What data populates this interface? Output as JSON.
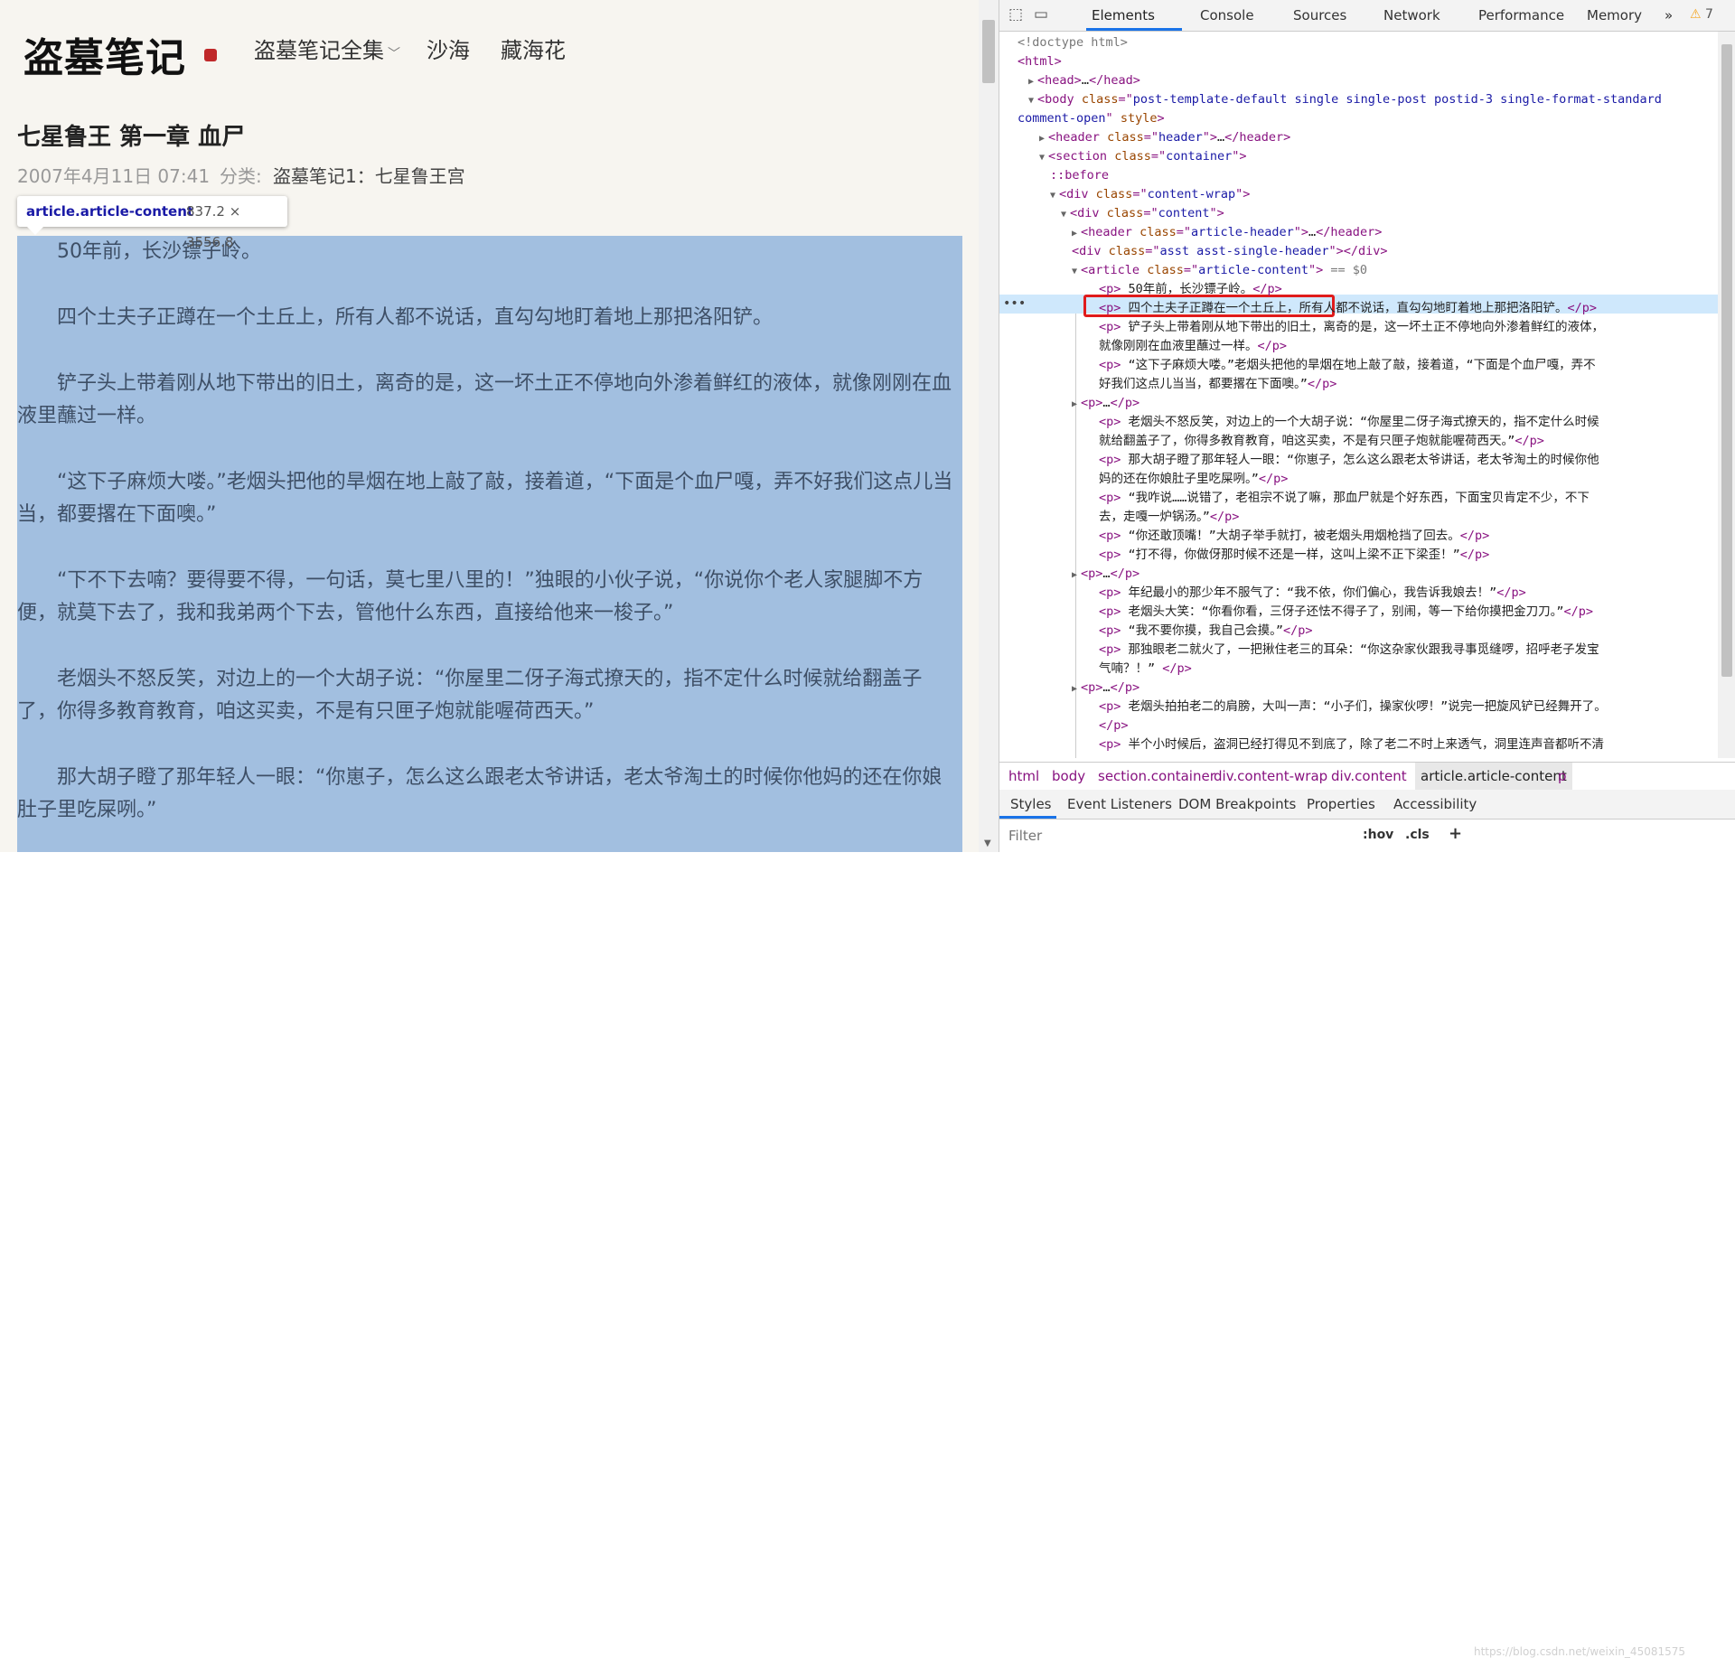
{
  "site": {
    "logo": "盗墓笔记",
    "nav": [
      {
        "label": "盗墓笔记全集",
        "has_dropdown": true
      },
      {
        "label": "沙海"
      },
      {
        "label": "藏海花"
      }
    ]
  },
  "article": {
    "title": "七星鲁王 第一章 血尸",
    "date": "2007年4月11日 07:41",
    "category_label": "分类:",
    "category": "盗墓笔记1：七星鲁王宫",
    "paragraphs": [
      "50年前，长沙镖子岭。",
      "四个土夫子正蹲在一个土丘上，所有人都不说话，直勾勾地盯着地上那把洛阳铲。",
      "铲子头上带着刚从地下带出的旧土，离奇的是，这一坏土正不停地向外渗着鲜红的液体，就像刚刚在血液里蘸过一样。",
      "“这下子麻烦大喽。”老烟头把他的旱烟在地上敲了敲，接着道，“下面是个血尸嘎，弄不好我们这点儿当当，都要撂在下面噢。”",
      "“下不下去喃？要得要不得，一句话，莫七里八里的！”独眼的小伙子说，“你说你个老人家腿脚不方便，就莫下去了，我和我弟两个下去，管他什么东西，直接给他来一梭子。”",
      "老烟头不怒反笑，对边上的一个大胡子说：“你屋里二伢子海式撩天的，指不定什么时候就给翻盖子了，你得多教育教育，咱这买卖，不是有只匣子炮就能喔荷西天。”",
      "那大胡子瞪了那年轻人一眼：“你崽子，怎么这么跟老太爷讲话，老太爷淘土的时候你他妈的还在你娘肚子里吃屎咧。”"
    ]
  },
  "inspect_tooltip": {
    "element": "article.article-content",
    "size": "837.2 × 3556.8"
  },
  "devtools": {
    "tabs": [
      "Elements",
      "Console",
      "Sources",
      "Network",
      "Performance",
      "Memory"
    ],
    "more": "»",
    "warnings": "7",
    "dom_lines": [
      {
        "indent": 0,
        "tri": "",
        "parts": [
          [
            "cm",
            "<!doctype html>"
          ]
        ]
      },
      {
        "indent": 0,
        "tri": "",
        "parts": [
          [
            "tg",
            "<html>"
          ]
        ]
      },
      {
        "indent": 1,
        "tri": "▶",
        "parts": [
          [
            "tg",
            "<head>"
          ],
          [
            "tx",
            "…"
          ],
          [
            "tg",
            "</head>"
          ]
        ]
      },
      {
        "indent": 1,
        "tri": "▼",
        "parts": [
          [
            "tg",
            "<body "
          ],
          [
            "an",
            "class"
          ],
          [
            "tg",
            "=\""
          ],
          [
            "av",
            "post-template-default single single-post postid-3 single-format-standard"
          ]
        ]
      },
      {
        "indent": 0,
        "tri": "",
        "parts": [
          [
            "av",
            "comment-open"
          ],
          [
            "tg",
            "\" "
          ],
          [
            "an",
            "style"
          ],
          [
            "tg",
            ">"
          ]
        ]
      },
      {
        "indent": 2,
        "tri": "▶",
        "parts": [
          [
            "tg",
            "<header "
          ],
          [
            "an",
            "class"
          ],
          [
            "tg",
            "=\""
          ],
          [
            "av",
            "header"
          ],
          [
            "tg",
            "\">"
          ],
          [
            "tx",
            "…"
          ],
          [
            "tg",
            "</header>"
          ]
        ]
      },
      {
        "indent": 2,
        "tri": "▼",
        "parts": [
          [
            "tg",
            "<section "
          ],
          [
            "an",
            "class"
          ],
          [
            "tg",
            "=\""
          ],
          [
            "av",
            "container"
          ],
          [
            "tg",
            "\">"
          ]
        ]
      },
      {
        "indent": 3,
        "tri": "",
        "parts": [
          [
            "tg",
            "::before"
          ]
        ]
      },
      {
        "indent": 3,
        "tri": "▼",
        "parts": [
          [
            "tg",
            "<div "
          ],
          [
            "an",
            "class"
          ],
          [
            "tg",
            "=\""
          ],
          [
            "av",
            "content-wrap"
          ],
          [
            "tg",
            "\">"
          ]
        ]
      },
      {
        "indent": 4,
        "tri": "▼",
        "parts": [
          [
            "tg",
            "<div "
          ],
          [
            "an",
            "class"
          ],
          [
            "tg",
            "=\""
          ],
          [
            "av",
            "content"
          ],
          [
            "tg",
            "\">"
          ]
        ]
      },
      {
        "indent": 5,
        "tri": "▶",
        "parts": [
          [
            "tg",
            "<header "
          ],
          [
            "an",
            "class"
          ],
          [
            "tg",
            "=\""
          ],
          [
            "av",
            "article-header"
          ],
          [
            "tg",
            "\">"
          ],
          [
            "tx",
            "…"
          ],
          [
            "tg",
            "</header>"
          ]
        ]
      },
      {
        "indent": 5,
        "tri": "",
        "parts": [
          [
            "tg",
            "<div "
          ],
          [
            "an",
            "class"
          ],
          [
            "tg",
            "=\""
          ],
          [
            "av",
            "asst asst-single-header"
          ],
          [
            "tg",
            "\"></div>"
          ]
        ]
      },
      {
        "indent": 5,
        "tri": "▼",
        "parts": [
          [
            "tg",
            "<article "
          ],
          [
            "an",
            "class"
          ],
          [
            "tg",
            "=\""
          ],
          [
            "av",
            "article-content"
          ],
          [
            "tg",
            "\">"
          ],
          [
            "cm",
            " == $0"
          ]
        ]
      },
      {
        "indent": 6,
        "tri": "",
        "parts": [
          [
            "tg",
            "<p>"
          ],
          [
            "tx",
            "    50年前，长沙镖子岭。"
          ],
          [
            "tg",
            "</p>"
          ]
        ]
      },
      {
        "indent": 6,
        "tri": "",
        "parts": [
          [
            "tg",
            "<p>"
          ],
          [
            "tx",
            "    四个土夫子正蹲在一个土丘上，所有人都不说话，直勾勾地盯着地上那把洛阳铲。"
          ],
          [
            "tg",
            "</p>"
          ]
        ]
      },
      {
        "indent": 6,
        "tri": "",
        "parts": [
          [
            "tg",
            "<p>"
          ],
          [
            "tx",
            "    铲子头上带着刚从地下带出的旧土，离奇的是，这一坏土正不停地向外渗着鲜红的液体，"
          ]
        ]
      },
      {
        "indent": 6,
        "tri": "",
        "parts": [
          [
            "tx",
            "就像刚刚在血液里蘸过一样。"
          ],
          [
            "tg",
            "</p>"
          ]
        ]
      },
      {
        "indent": 6,
        "tri": "",
        "parts": [
          [
            "tg",
            "<p>"
          ],
          [
            "tx",
            "    “这下子麻烦大喽。”老烟头把他的旱烟在地上敲了敲，接着道，“下面是个血尸嘎，弄不"
          ]
        ]
      },
      {
        "indent": 6,
        "tri": "",
        "parts": [
          [
            "tx",
            "好我们这点儿当当，都要撂在下面噢。”"
          ],
          [
            "tg",
            "</p>"
          ]
        ]
      },
      {
        "indent": 5,
        "tri": "▶",
        "parts": [
          [
            "tg",
            "<p>"
          ],
          [
            "tx",
            "…"
          ],
          [
            "tg",
            "</p>"
          ]
        ]
      },
      {
        "indent": 6,
        "tri": "",
        "parts": [
          [
            "tg",
            "<p>"
          ],
          [
            "tx",
            "    老烟头不怒反笑，对边上的一个大胡子说：“你屋里二伢子海式撩天的，指不定什么时候"
          ]
        ]
      },
      {
        "indent": 6,
        "tri": "",
        "parts": [
          [
            "tx",
            "就给翻盖子了，你得多教育教育，咱这买卖，不是有只匣子炮就能喔荷西天。”"
          ],
          [
            "tg",
            "</p>"
          ]
        ]
      },
      {
        "indent": 6,
        "tri": "",
        "parts": [
          [
            "tg",
            "<p>"
          ],
          [
            "tx",
            "    那大胡子瞪了那年轻人一眼：“你崽子，怎么这么跟老太爷讲话，老太爷淘土的时候你他"
          ]
        ]
      },
      {
        "indent": 6,
        "tri": "",
        "parts": [
          [
            "tx",
            "妈的还在你娘肚子里吃屎咧。”"
          ],
          [
            "tg",
            "</p>"
          ]
        ]
      },
      {
        "indent": 6,
        "tri": "",
        "parts": [
          [
            "tg",
            "<p>"
          ],
          [
            "tx",
            "    “我咋说……说错了，老祖宗不说了嘛，那血尸就是个好东西，下面宝贝肯定不少，不下"
          ]
        ]
      },
      {
        "indent": 6,
        "tri": "",
        "parts": [
          [
            "tx",
            "去，走嘎一炉锅汤。”"
          ],
          [
            "tg",
            "</p>"
          ]
        ]
      },
      {
        "indent": 6,
        "tri": "",
        "parts": [
          [
            "tg",
            "<p>"
          ],
          [
            "tx",
            "    “你还敢顶嘴！”大胡子举手就打，被老烟头用烟枪挡了回去。"
          ],
          [
            "tg",
            "</p>"
          ]
        ]
      },
      {
        "indent": 6,
        "tri": "",
        "parts": [
          [
            "tg",
            "<p>"
          ],
          [
            "tx",
            "    “打不得，你做伢那时候不还是一样，这叫上梁不正下梁歪！”"
          ],
          [
            "tg",
            "</p>"
          ]
        ]
      },
      {
        "indent": 5,
        "tri": "▶",
        "parts": [
          [
            "tg",
            "<p>"
          ],
          [
            "tx",
            "…"
          ],
          [
            "tg",
            "</p>"
          ]
        ]
      },
      {
        "indent": 6,
        "tri": "",
        "parts": [
          [
            "tg",
            "<p>"
          ],
          [
            "tx",
            "    年纪最小的那少年不服气了：“我不依，你们偏心，我告诉我娘去！”"
          ],
          [
            "tg",
            "</p>"
          ]
        ]
      },
      {
        "indent": 6,
        "tri": "",
        "parts": [
          [
            "tg",
            "<p>"
          ],
          [
            "tx",
            "    老烟头大笑：“你看你看，三伢子还怯不得子了，别闹，等一下给你摸把金刀刀。”"
          ],
          [
            "tg",
            "</p>"
          ]
        ]
      },
      {
        "indent": 6,
        "tri": "",
        "parts": [
          [
            "tg",
            "<p>"
          ],
          [
            "tx",
            "    “我不要你摸，我自己会摸。”"
          ],
          [
            "tg",
            "</p>"
          ]
        ]
      },
      {
        "indent": 6,
        "tri": "",
        "parts": [
          [
            "tg",
            "<p>"
          ],
          [
            "tx",
            "    那独眼老二就火了，一把揪住老三的耳朵：“你这杂家伙跟我寻事觅缝啰，招呼老子发宝"
          ]
        ]
      },
      {
        "indent": 6,
        "tri": "",
        "parts": [
          [
            "tx",
            "气喃？！”"
          ],
          [
            "tg",
            " </p>"
          ]
        ]
      },
      {
        "indent": 5,
        "tri": "▶",
        "parts": [
          [
            "tg",
            "<p>"
          ],
          [
            "tx",
            "…"
          ],
          [
            "tg",
            "</p>"
          ]
        ]
      },
      {
        "indent": 6,
        "tri": "",
        "parts": [
          [
            "tg",
            "<p>"
          ],
          [
            "tx",
            "    老烟头拍拍老二的肩膀，大叫一声：“小子们，操家伙啰！”说完一把旋风铲已经舞开了。"
          ]
        ]
      },
      {
        "indent": 6,
        "tri": "",
        "parts": [
          [
            "tg",
            "</p>"
          ]
        ]
      },
      {
        "indent": 6,
        "tri": "",
        "parts": [
          [
            "tg",
            "<p>"
          ],
          [
            "tx",
            "    半个小时候后，盗洞已经打得见不到底了，除了老二不时上来透气，洞里连声音都听不清"
          ]
        ]
      }
    ],
    "breadcrumbs": [
      "html",
      "body",
      "section.container",
      "div.content-wrap",
      "div.content",
      "article.article-content",
      "p"
    ],
    "sub_tabs": [
      "Styles",
      "Event Listeners",
      "DOM Breakpoints",
      "Properties",
      "Accessibility"
    ],
    "filter_placeholder": "Filter",
    "hov": ":hov",
    "cls": ".cls",
    "plus": "+",
    "watermark": "https://blog.csdn.net/weixin_45081575"
  }
}
